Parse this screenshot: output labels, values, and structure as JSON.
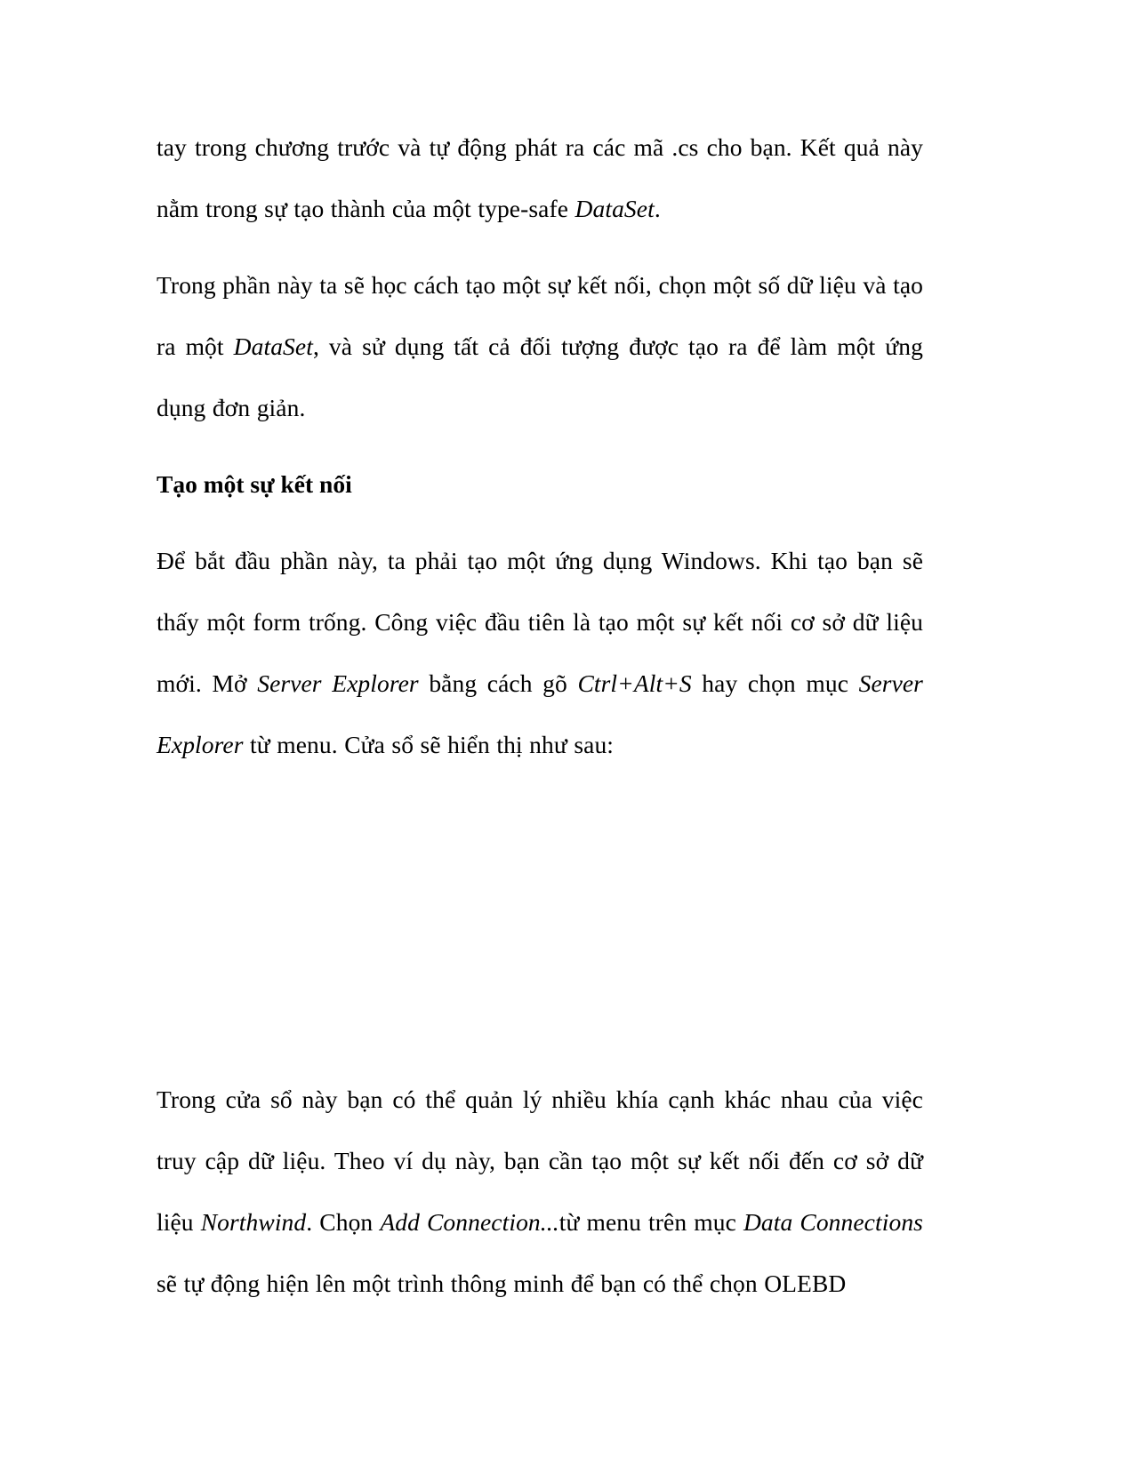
{
  "document": {
    "page_background": "#ffffff",
    "text_color": "#000000",
    "blocks": [
      {
        "id": "para-1",
        "type": "paragraph",
        "runs": [
          {
            "text": "tay trong chương trước và tự động phát ra các mã .cs cho bạn. Kết quả này nằm trong sự tạo thành của một type-safe ",
            "style": "normal"
          },
          {
            "text": "DataSet",
            "style": "italic"
          },
          {
            "text": ".",
            "style": "normal"
          }
        ]
      },
      {
        "id": "para-2",
        "type": "paragraph",
        "runs": [
          {
            "text": "Trong phần này ta sẽ học cách tạo một sự kết nối, chọn một số dữ liệu và tạo ra một ",
            "style": "normal"
          },
          {
            "text": "DataSet",
            "style": "italic"
          },
          {
            "text": ", và sử dụng tất cả đối tượng được tạo ra để làm một ứng dụng đơn giản.",
            "style": "normal"
          }
        ]
      },
      {
        "id": "heading-1",
        "type": "heading",
        "runs": [
          {
            "text": "Tạo một sự kết nối",
            "style": "bold"
          }
        ]
      },
      {
        "id": "para-3",
        "type": "paragraph",
        "runs": [
          {
            "text": "Để bắt đầu phần này, ta phải tạo một ứng dụng Windows. Khi tạo bạn sẽ thấy một form trống. Công việc đầu tiên là tạo một sự kết nối cơ sở dữ liệu mới. Mở ",
            "style": "normal"
          },
          {
            "text": "Server Explorer",
            "style": "italic"
          },
          {
            "text": " bằng cách gõ ",
            "style": "normal"
          },
          {
            "text": "Ctrl+Alt+S",
            "style": "italic"
          },
          {
            "text": " hay chọn mục ",
            "style": "normal"
          },
          {
            "text": "Server Explorer",
            "style": "italic"
          },
          {
            "text": " từ menu. Cửa sổ sẽ hiển thị như sau:",
            "style": "normal"
          }
        ]
      },
      {
        "id": "figure-placeholder",
        "type": "figure",
        "caption": ""
      },
      {
        "id": "para-4",
        "type": "paragraph",
        "runs": [
          {
            "text": "Trong cửa sổ này bạn có thể quản lý nhiều khía cạnh khác nhau của việc truy cập dữ liệu. Theo ví dụ này, bạn cần tạo một sự kết nối đến cơ sở dữ liệu ",
            "style": "normal"
          },
          {
            "text": "Northwind",
            "style": "italic"
          },
          {
            "text": ". Chọn ",
            "style": "normal"
          },
          {
            "text": "Add Connection...",
            "style": "italic"
          },
          {
            "text": "từ menu trên mục ",
            "style": "normal"
          },
          {
            "text": "Data Connections",
            "style": "italic"
          },
          {
            "text": " sẽ tự động hiện lên một trình thông minh để bạn có thể chọn OLEBD",
            "style": "normal"
          }
        ]
      }
    ]
  }
}
